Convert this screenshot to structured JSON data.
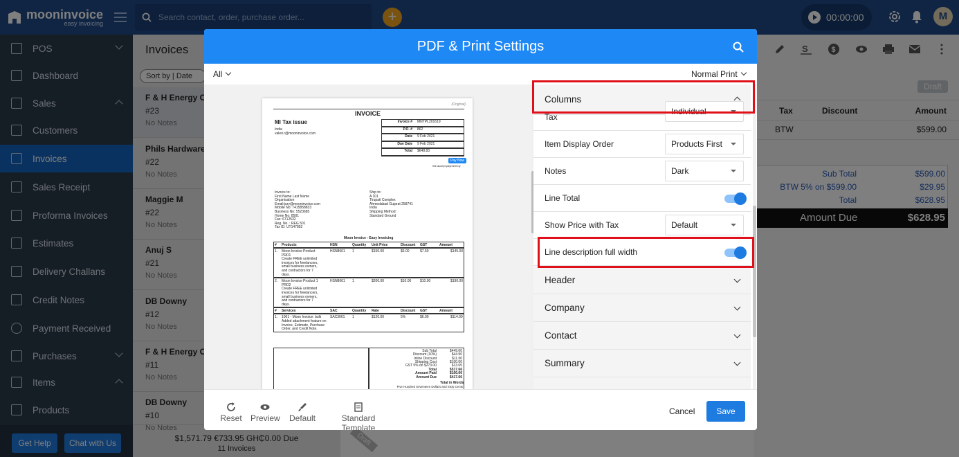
{
  "app": {
    "name": "mooninvoice",
    "tagline": "easy invoicing",
    "search_placeholder": "Search contact, order, purchase order...",
    "timer": "00:00:00",
    "avatar": "M"
  },
  "sidebar": {
    "items": [
      {
        "label": "POS"
      },
      {
        "label": "Dashboard"
      },
      {
        "label": "Sales"
      },
      {
        "label": "Customers"
      },
      {
        "label": "Invoices"
      },
      {
        "label": "Sales Receipt"
      },
      {
        "label": "Proforma Invoices"
      },
      {
        "label": "Estimates"
      },
      {
        "label": "Delivery Challans"
      },
      {
        "label": "Credit Notes"
      },
      {
        "label": "Payment Received"
      },
      {
        "label": "Purchases"
      },
      {
        "label": "Items"
      },
      {
        "label": "Products"
      }
    ],
    "help": "Get Help",
    "chat": "Chat with Us"
  },
  "list": {
    "title": "Invoices",
    "sort": "Sort by | Date",
    "invoices": [
      {
        "name": "F & H Energy Co",
        "number": "#23",
        "notes": "No Notes"
      },
      {
        "name": "Phils Hardware",
        "number": "#22",
        "notes": "No Notes"
      },
      {
        "name": "Maggie M",
        "number": "#22",
        "notes": "No Notes"
      },
      {
        "name": "Anuj S",
        "number": "#21",
        "notes": "No Notes"
      },
      {
        "name": "DB Downy",
        "number": "#12",
        "notes": "No Notes"
      },
      {
        "name": "F & H Energy Co",
        "number": "#11",
        "notes": "No Notes"
      },
      {
        "name": "DB Downy",
        "number": "#10",
        "notes": "No Notes"
      }
    ],
    "totals": "$1,571.79 €733.95 GH₵0.00 Due",
    "count": "11 Invoices",
    "draft_tag": "Draft"
  },
  "detail": {
    "status": "Draft",
    "headers": {
      "tax": "Tax",
      "discount": "Discount",
      "amount": "Amount"
    },
    "line": {
      "tax": "BTW",
      "amount": "$599.00"
    },
    "summary": [
      {
        "label": "Sub Total",
        "value": "$599.00"
      },
      {
        "label": "BTW 5% on $599.00",
        "value": "$29.95"
      },
      {
        "label": "Total",
        "value": "$628.95"
      }
    ],
    "amount_due": {
      "label": "Amount Due",
      "value": "$628.95"
    }
  },
  "modal": {
    "title": "PDF & Print Settings",
    "filter": "All",
    "print_mode": "Normal Print",
    "sections": {
      "columns": "Columns",
      "header": "Header",
      "company": "Company",
      "contact": "Contact",
      "summary": "Summary"
    },
    "rows": {
      "tax": {
        "label": "Tax",
        "value": "Individual"
      },
      "item_order": {
        "label": "Item Display Order",
        "value": "Products First"
      },
      "notes": {
        "label": "Notes",
        "value": "Dark"
      },
      "line_total": {
        "label": "Line Total"
      },
      "show_price": {
        "label": "Show Price with Tax",
        "value": "Default"
      },
      "line_desc": {
        "label": "Line description full width"
      }
    },
    "footer": {
      "reset": "Reset",
      "preview": "Preview",
      "default": "Default",
      "template": "Standard Template",
      "cancel": "Cancel",
      "save": "Save"
    }
  },
  "preview": {
    "original": "(Original)",
    "title": "INVOICE",
    "company": "MI Tax issue",
    "country": "India",
    "email": "valeri.r@mooninvoice.com",
    "meta": [
      {
        "k": "Invoice #",
        "v": "MNTPL201619"
      },
      {
        "k": "P.O. #",
        "v": "862"
      },
      {
        "k": "Date",
        "v": "9 Feb 2021"
      },
      {
        "k": "Due Date",
        "v": "9 Feb 2021"
      },
      {
        "k": "Total",
        "v": "$648.83"
      }
    ],
    "pay_now": "Pay Now",
    "accept_text": "We accept payment by",
    "bill_to": [
      "Invoice to:",
      "First Name Last Name",
      "Organisation",
      "Email:jury@mooninvoice.com",
      "Mobile No: 7415858833",
      "Business No: 5523685",
      "Home No: 8501",
      "Fax: 6712532",
      "Reg. No. : REG 501",
      "Tax ID: UT147852"
    ],
    "ship_to": [
      "Ship to:",
      "A 101",
      "Tirupati Complex",
      "Ahmedabad Gujarat 258741",
      "India",
      "Shipping Method:",
      "Standard Ground"
    ],
    "tagline": "Moon Invoice - Easy Invoicing",
    "prod_head": [
      "#",
      "Products",
      "HSN",
      "Quantity",
      "Unit Price",
      "Discount",
      "GST",
      "Amount"
    ],
    "products": [
      {
        "n": "1.",
        "desc": [
          "Moon Invoice Product",
          "PRD1",
          "Create FREE unlimited",
          "invoices for freelancers,",
          "small business owners,",
          "and contractors for 7",
          "days."
        ],
        "hsn": "HSN8661",
        "qty": "1",
        "price": "$150.00",
        "disc": "$5.00",
        "gst": "$7.50",
        "amt": "$145.00"
      },
      {
        "n": "2.",
        "desc": [
          "Moon Invoice Product 1",
          "PRD2",
          "Create FREE unlimited",
          "invoices for freelancers,",
          "small business owners,",
          "and contractors for 7",
          "days."
        ],
        "hsn": "HSN8661",
        "qty": "1",
        "price": "$200.00",
        "disc": "$10.00",
        "gst": "$10.00",
        "amt": "$190.00"
      }
    ],
    "serv_head": [
      "#",
      "Services",
      "SAC",
      "Quantity",
      "Rate",
      "Discount",
      "GST",
      "Amount"
    ],
    "services": [
      {
        "n": "1.",
        "desc": [
          "1001 - Moon Invoice: bulk",
          "Added attachment feature on",
          "Invoice, Estimate, Purchase",
          "Order, and Credit Note."
        ],
        "sac": "SAC3661",
        "qty": "1",
        "rate": "$120.00",
        "disc": "5%",
        "gst": "$6.00",
        "amt": "$114.00"
      }
    ],
    "totals": [
      {
        "k": "Sub Total",
        "v": "$449.00"
      },
      {
        "k": "Discount (10%)",
        "v": "$44.90"
      },
      {
        "k": "Inline Discount",
        "v": "$11.00"
      },
      {
        "k": "Shipping Cost",
        "v": "$100.00"
      },
      {
        "k": "GST 5% on $273.00",
        "v": "$13.65"
      },
      {
        "k": "Total",
        "v": "$517.66"
      },
      {
        "k": "Amount Paid",
        "v": "$100.00"
      },
      {
        "k": "Amount Due",
        "v": "$417.66"
      }
    ],
    "words_label": "Total in Words",
    "words": "Five Hundred Seventeen Dollars and Sixty Cents"
  }
}
